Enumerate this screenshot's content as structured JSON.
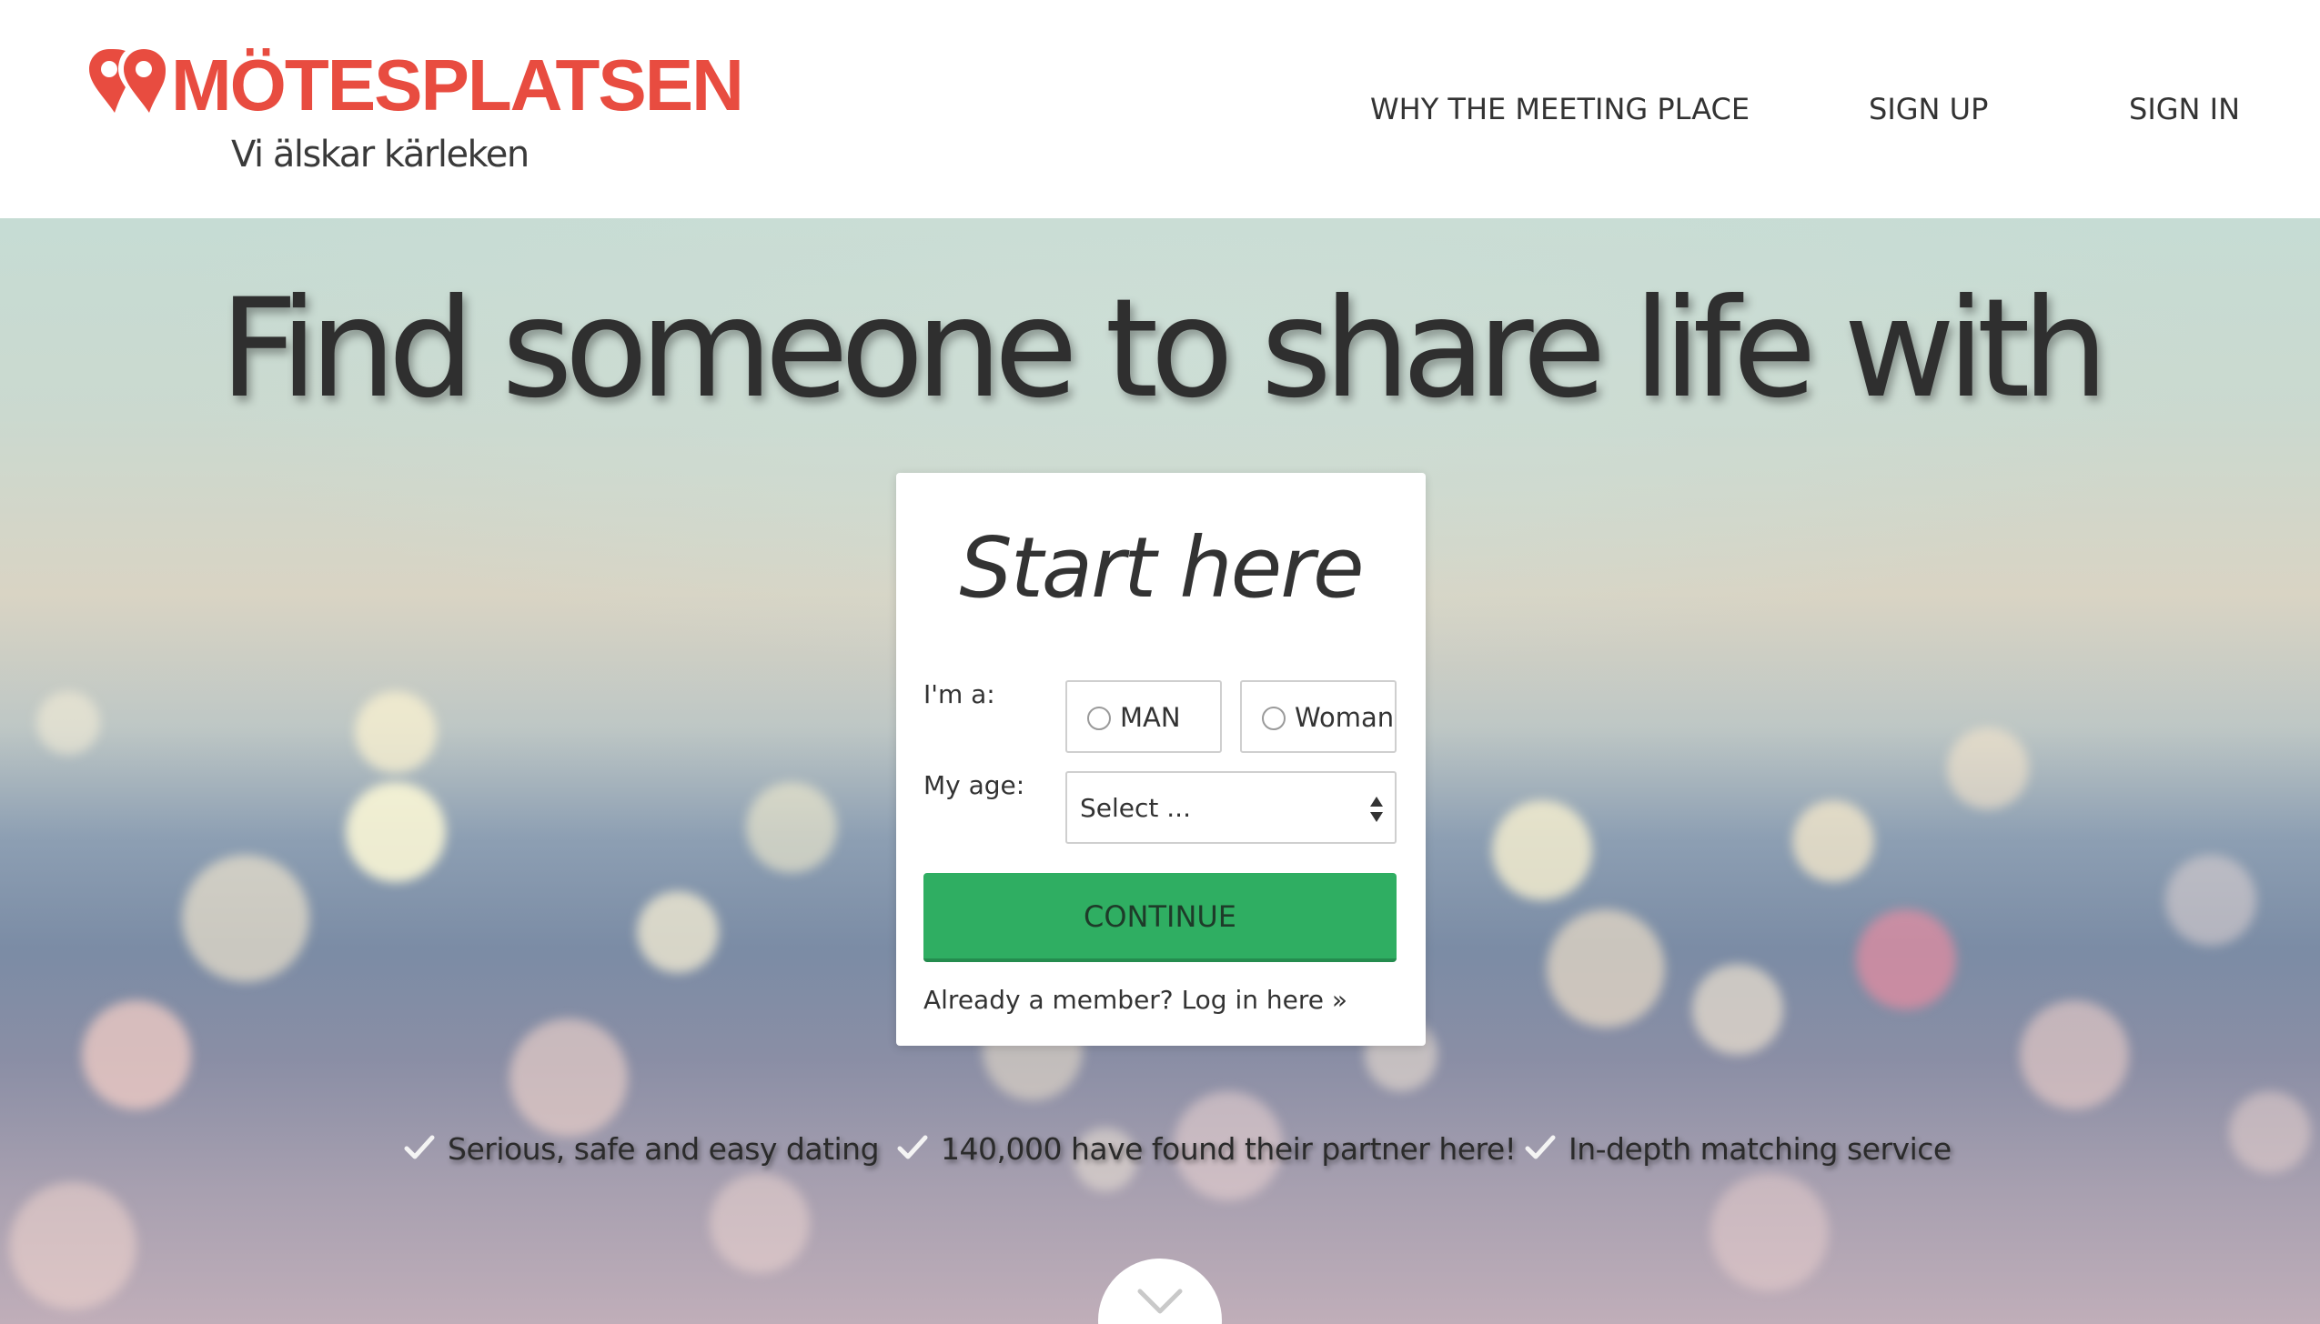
{
  "brand": {
    "name": "MÖTESPLATSEN",
    "tagline": "Vi älskar kärleken",
    "color": "#e84c40",
    "logo_icon": "heart-pin-icon"
  },
  "nav": {
    "items": [
      {
        "label": "WHY THE MEETING PLACE"
      },
      {
        "label": "SIGN UP"
      },
      {
        "label": "SIGN IN"
      }
    ]
  },
  "hero": {
    "headline": "Find someone to share life with"
  },
  "signup": {
    "title": "Start here",
    "gender_label": "I'm a:",
    "gender_options": [
      {
        "label": "MAN",
        "selected": false
      },
      {
        "label": "Woman",
        "selected": false
      }
    ],
    "age_label": "My age:",
    "age_select_value": "Select ...",
    "continue_label": "CONTINUE",
    "continue_color": "#2fae62",
    "login_text": "Already a member? Log in here »"
  },
  "features": [
    {
      "text": "Serious, safe and easy dating",
      "icon": "check-icon"
    },
    {
      "text": "140,000 have found their partner here!",
      "icon": "check-icon"
    },
    {
      "text": "In-depth matching service",
      "icon": "check-icon"
    }
  ],
  "scroll_icon": "chevron-down-icon"
}
